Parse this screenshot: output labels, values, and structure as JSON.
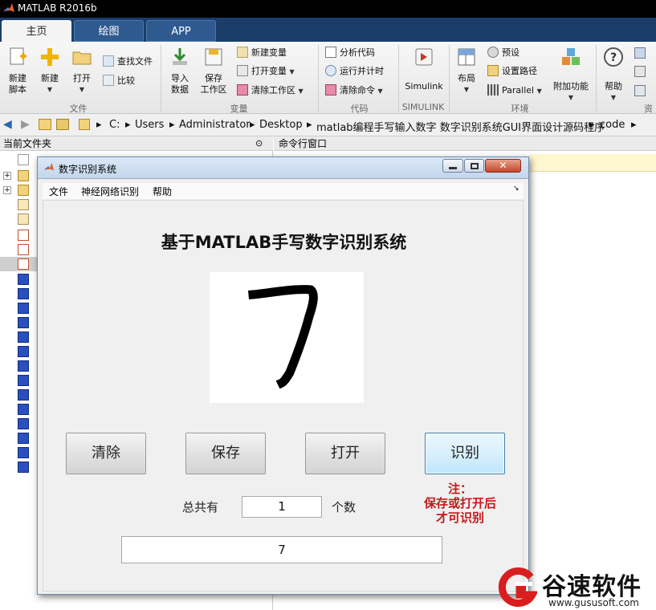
{
  "app": {
    "title": "MATLAB R2016b"
  },
  "tabs": [
    {
      "label": "主页"
    },
    {
      "label": "绘图"
    },
    {
      "label": "APP"
    }
  ],
  "ribbon": {
    "file": {
      "group": "文件",
      "new_script": "新建\n脚本",
      "new": "新建",
      "open": "打开",
      "find_files": "查找文件",
      "compare": "比较"
    },
    "variable": {
      "group": "变量",
      "import": "导入\n数据",
      "save_ws": "保存\n工作区",
      "new_var": "新建变量",
      "open_var": "打开变量",
      "clear_ws": "清除工作区"
    },
    "code": {
      "group": "代码",
      "analyze": "分析代码",
      "run_time": "运行并计时",
      "clear_cmd": "清除命令"
    },
    "simulink": {
      "group": "SIMULINK",
      "label": "Simulink"
    },
    "env": {
      "group": "环境",
      "layout": "布局",
      "prefs": "预设",
      "set_path": "设置路径",
      "parallel": "Parallel",
      "addons": "附加功能"
    },
    "resources": {
      "group": "资",
      "help": "帮助"
    }
  },
  "address": {
    "path": [
      "C:",
      "Users",
      "Administrator",
      "Desktop",
      "matlab编程手写输入数字 数字识别系统GUI界面设计源码程序",
      "code"
    ]
  },
  "panes": {
    "current_folder": "当前文件夹",
    "command_window": "命令行窗口"
  },
  "gui": {
    "window_title": "数字识别系统",
    "menu": [
      "文件",
      "神经网络识别",
      "帮助"
    ],
    "title": "基于MATLAB手写数字识别系统",
    "buttons": {
      "clear": "清除",
      "save": "保存",
      "open": "打开",
      "recognize": "识别"
    },
    "count_prefix": "总共有",
    "count_value": "1",
    "count_suffix": "个数",
    "note": [
      "注：",
      "保存或打开后",
      "才可识别"
    ],
    "result": "7"
  },
  "watermark": {
    "brand": "谷速软件",
    "url": "www.gususoft.com"
  }
}
